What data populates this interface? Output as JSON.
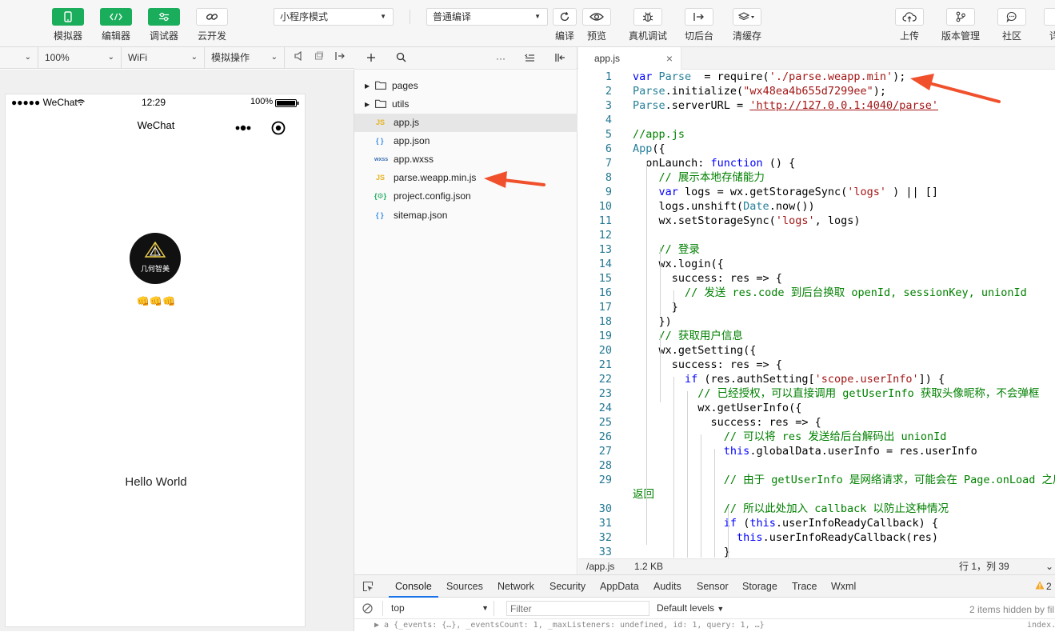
{
  "toolbar": {
    "buttons": [
      {
        "label": "模拟器",
        "icon": "phone-icon"
      },
      {
        "label": "编辑器",
        "icon": "code-icon"
      },
      {
        "label": "调试器",
        "icon": "debug-sliders-icon"
      },
      {
        "label": "云开发",
        "icon": "cloud-link-icon"
      }
    ],
    "mode_select": "小程序模式",
    "compile_select": "普通编译",
    "actions": [
      {
        "label": "编译",
        "icon": "refresh-icon"
      },
      {
        "label": "预览",
        "icon": "eye-icon"
      },
      {
        "label": "真机调试",
        "icon": "bug-icon"
      },
      {
        "label": "切后台",
        "icon": "switch-background-icon"
      },
      {
        "label": "清缓存",
        "icon": "layers-icon"
      }
    ],
    "right_actions": [
      {
        "label": "上传",
        "icon": "upload-cloud-icon"
      },
      {
        "label": "版本管理",
        "icon": "branch-icon"
      },
      {
        "label": "社区",
        "icon": "chat-icon"
      },
      {
        "label": "详",
        "icon": "details-icon"
      }
    ]
  },
  "sim_bar": {
    "device": "",
    "zoom": "100%",
    "network": "WiFi",
    "ops": "模拟操作"
  },
  "phone": {
    "carrier": "●●●●● WeChat",
    "time": "12:29",
    "battery": "100%",
    "nav_title": "WeChat",
    "avatar_text": "几何智美",
    "emoji": "👊👊👊",
    "hello": "Hello World"
  },
  "explorer": {
    "files": [
      {
        "name": "pages",
        "type": "folder",
        "icon": "folder-icon"
      },
      {
        "name": "utils",
        "type": "folder",
        "icon": "folder-icon"
      },
      {
        "name": "app.js",
        "type": "js",
        "badge": "JS",
        "badge_color": "#e6b422"
      },
      {
        "name": "app.json",
        "type": "json",
        "badge": "{ }",
        "badge_color": "#3a8ee6"
      },
      {
        "name": "app.wxss",
        "type": "wxss",
        "badge": "wxss",
        "badge_color": "#3a6fb0"
      },
      {
        "name": "parse.weapp.min.js",
        "type": "js",
        "badge": "JS",
        "badge_color": "#e6b422"
      },
      {
        "name": "project.config.json",
        "type": "config",
        "badge": "{⚙}",
        "badge_color": "#1aad5c"
      },
      {
        "name": "sitemap.json",
        "type": "json",
        "badge": "{ }",
        "badge_color": "#3a8ee6"
      }
    ]
  },
  "editor": {
    "tab": "app.js",
    "status_path": "/app.js",
    "status_size": "1.2 KB",
    "status_pos": "行 1，列 39",
    "lines": [
      {
        "n": "1",
        "tokens": [
          [
            "kw",
            "var "
          ],
          [
            "ty",
            "Parse"
          ],
          [
            "",
            "  = require("
          ],
          [
            "str",
            "'./parse.weapp.min'"
          ],
          [
            "",
            ");"
          ]
        ]
      },
      {
        "n": "2",
        "tokens": [
          [
            "ty",
            "Parse"
          ],
          [
            "",
            ".initialize("
          ],
          [
            "str",
            "\"wx48ea4b655d7299ee\""
          ],
          [
            "",
            ");"
          ]
        ]
      },
      {
        "n": "3",
        "tokens": [
          [
            "ty",
            "Parse"
          ],
          [
            "",
            ".serverURL = "
          ],
          [
            "url",
            "'http://127.0.0.1:4040/parse'"
          ]
        ]
      },
      {
        "n": "4",
        "tokens": []
      },
      {
        "n": "5",
        "tokens": [
          [
            "cm",
            "//app.js"
          ]
        ]
      },
      {
        "n": "6",
        "tokens": [
          [
            "ty",
            "App"
          ],
          [
            "",
            "({"
          ]
        ]
      },
      {
        "n": "7",
        "tokens": [
          [
            "",
            "  onLaunch: "
          ],
          [
            "kw",
            "function"
          ],
          [
            "",
            " () {"
          ]
        ]
      },
      {
        "n": "8",
        "tokens": [
          [
            "",
            "    "
          ],
          [
            "cm",
            "// 展示本地存储能力"
          ]
        ]
      },
      {
        "n": "9",
        "tokens": [
          [
            "",
            "    "
          ],
          [
            "kw",
            "var"
          ],
          [
            "",
            " logs = wx.getStorageSync("
          ],
          [
            "str",
            "'logs'"
          ],
          [
            "",
            " ) || []"
          ]
        ]
      },
      {
        "n": "10",
        "tokens": [
          [
            "",
            "    logs.unshift("
          ],
          [
            "ty",
            "Date"
          ],
          [
            "",
            ".now())"
          ]
        ]
      },
      {
        "n": "11",
        "tokens": [
          [
            "",
            "    wx.setStorageSync("
          ],
          [
            "str",
            "'logs'"
          ],
          [
            "",
            ", logs)"
          ]
        ]
      },
      {
        "n": "12",
        "tokens": []
      },
      {
        "n": "13",
        "tokens": [
          [
            "",
            "    "
          ],
          [
            "cm",
            "// 登录"
          ]
        ]
      },
      {
        "n": "14",
        "tokens": [
          [
            "",
            "    wx.login({"
          ]
        ]
      },
      {
        "n": "15",
        "tokens": [
          [
            "",
            "      success: res => {"
          ]
        ]
      },
      {
        "n": "16",
        "tokens": [
          [
            "",
            "        "
          ],
          [
            "cm",
            "// 发送 res.code 到后台换取 openId, sessionKey, unionId"
          ]
        ]
      },
      {
        "n": "17",
        "tokens": [
          [
            "",
            "      }"
          ]
        ]
      },
      {
        "n": "18",
        "tokens": [
          [
            "",
            "    })"
          ]
        ]
      },
      {
        "n": "19",
        "tokens": [
          [
            "",
            "    "
          ],
          [
            "cm",
            "// 获取用户信息"
          ]
        ]
      },
      {
        "n": "20",
        "tokens": [
          [
            "",
            "    wx.getSetting({"
          ]
        ]
      },
      {
        "n": "21",
        "tokens": [
          [
            "",
            "      success: res => {"
          ]
        ]
      },
      {
        "n": "22",
        "tokens": [
          [
            "",
            "        "
          ],
          [
            "kw",
            "if"
          ],
          [
            "",
            " (res.authSetting["
          ],
          [
            "str",
            "'scope.userInfo'"
          ],
          [
            "",
            "]) {"
          ]
        ]
      },
      {
        "n": "23",
        "tokens": [
          [
            "",
            "          "
          ],
          [
            "cm",
            "// 已经授权，可以直接调用 getUserInfo 获取头像昵称，不会弹框"
          ]
        ]
      },
      {
        "n": "24",
        "tokens": [
          [
            "",
            "          wx.getUserInfo({"
          ]
        ]
      },
      {
        "n": "25",
        "tokens": [
          [
            "",
            "            success: res => {"
          ]
        ]
      },
      {
        "n": "26",
        "tokens": [
          [
            "",
            "              "
          ],
          [
            "cm",
            "// 可以将 res 发送给后台解码出 unionId"
          ]
        ]
      },
      {
        "n": "27",
        "tokens": [
          [
            "",
            "              "
          ],
          [
            "kw",
            "this"
          ],
          [
            "",
            ".globalData.userInfo = res.userInfo"
          ]
        ]
      },
      {
        "n": "28",
        "tokens": []
      },
      {
        "n": "29",
        "tokens": [
          [
            "",
            "              "
          ],
          [
            "cm",
            "// 由于 getUserInfo 是网络请求，可能会在 Page.onLoad 之后才"
          ]
        ]
      },
      {
        "n": "",
        "tokens": [
          [
            "cm",
            "返回"
          ]
        ]
      },
      {
        "n": "30",
        "tokens": [
          [
            "",
            "              "
          ],
          [
            "cm",
            "// 所以此处加入 callback 以防止这种情况"
          ]
        ]
      },
      {
        "n": "31",
        "tokens": [
          [
            "",
            "              "
          ],
          [
            "kw",
            "if"
          ],
          [
            "",
            " ("
          ],
          [
            "kw",
            "this"
          ],
          [
            "",
            ".userInfoReadyCallback) {"
          ]
        ]
      },
      {
        "n": "32",
        "tokens": [
          [
            "",
            "                "
          ],
          [
            "kw",
            "this"
          ],
          [
            "",
            ".userInfoReadyCallback(res)"
          ]
        ]
      },
      {
        "n": "33",
        "tokens": [
          [
            "",
            "              }"
          ]
        ]
      }
    ]
  },
  "console": {
    "tabs": [
      "Console",
      "Sources",
      "Network",
      "Security",
      "AppData",
      "Audits",
      "Sensor",
      "Storage",
      "Trace",
      "Wxml"
    ],
    "active_tab": "Console",
    "warn_count": "2",
    "context": "top",
    "filter_placeholder": "Filter",
    "levels": "Default levels",
    "hidden_msg": "2 items hidden by fil",
    "output": "▶ a {_events: {…}, _eventsCount: 1, _maxListeners: undefined, id: 1, query: 1, …}",
    "output_src": "index.j"
  },
  "colors": {
    "accent_green": "#1aad5c",
    "annotation_arrow": "#f0512c"
  }
}
